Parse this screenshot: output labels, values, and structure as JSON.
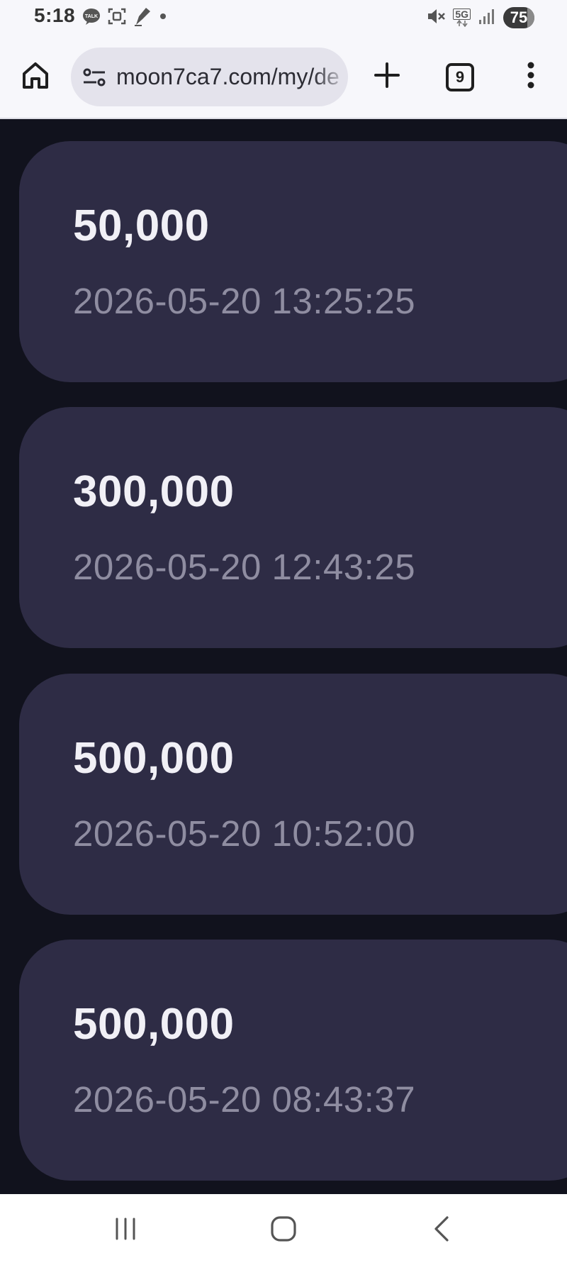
{
  "status_bar": {
    "time": "5:18",
    "network": "5G",
    "battery": "75",
    "left_icons": [
      "talk-notification-icon",
      "screenshot-icon",
      "pen-app-icon",
      "more-notifications-dot-icon"
    ],
    "right_icons": [
      "mute-icon",
      "5g-data-icon",
      "signal-icon",
      "battery-icon"
    ]
  },
  "browser": {
    "url": "moon7ca7.com/my/de",
    "tab_count": "9",
    "icons": [
      "home-icon",
      "site-info-icon",
      "plus-icon",
      "tab-switcher-icon",
      "more-vert-icon"
    ]
  },
  "records": [
    {
      "amount": "50,000",
      "datetime": "2026-05-20 13:25:25"
    },
    {
      "amount": "300,000",
      "datetime": "2026-05-20 12:43:25"
    },
    {
      "amount": "500,000",
      "datetime": "2026-05-20 10:52:00"
    },
    {
      "amount": "500,000",
      "datetime": "2026-05-20 08:43:37"
    }
  ],
  "nav_bar": {
    "icons": [
      "recent-apps-icon",
      "home-circle-icon",
      "back-icon"
    ]
  },
  "colors": {
    "page_background": "#11121d",
    "card_background": "#2e2c45",
    "amount_text": "#f1f0f6",
    "date_text": "#8f8da1",
    "browser_chrome": "#f7f7fb",
    "url_pill": "#e4e3ec"
  }
}
